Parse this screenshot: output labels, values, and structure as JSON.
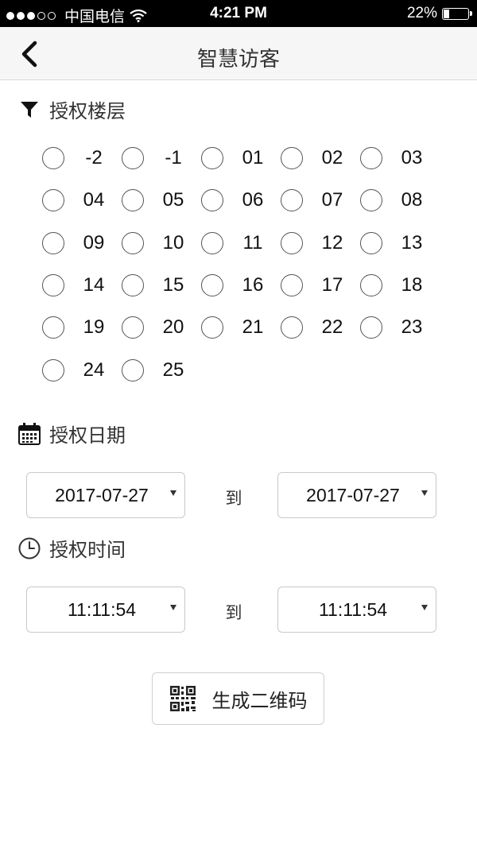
{
  "status_bar": {
    "carrier": "中国电信",
    "time": "4:21 PM",
    "battery": "22%",
    "battery_level": 0.22
  },
  "nav": {
    "title": "智慧访客",
    "back_icon": "chevron-left-icon"
  },
  "floor_section": {
    "title": "授权楼层",
    "icon": "filter-icon",
    "floors": [
      "-2",
      "-1",
      "01",
      "02",
      "03",
      "04",
      "05",
      "06",
      "07",
      "08",
      "09",
      "10",
      "11",
      "12",
      "13",
      "14",
      "15",
      "16",
      "17",
      "18",
      "19",
      "20",
      "21",
      "22",
      "23",
      "24",
      "25"
    ]
  },
  "date_section": {
    "title": "授权日期",
    "icon": "calendar-icon",
    "start": "2017-07-27",
    "to": "到",
    "end": "2017-07-27"
  },
  "time_section": {
    "title": "授权时间",
    "icon": "clock-icon",
    "start": "11:11:54",
    "to": "到",
    "end": "11:11:54"
  },
  "qr_button": {
    "label": "生成二维码",
    "icon": "qr-code-icon"
  }
}
